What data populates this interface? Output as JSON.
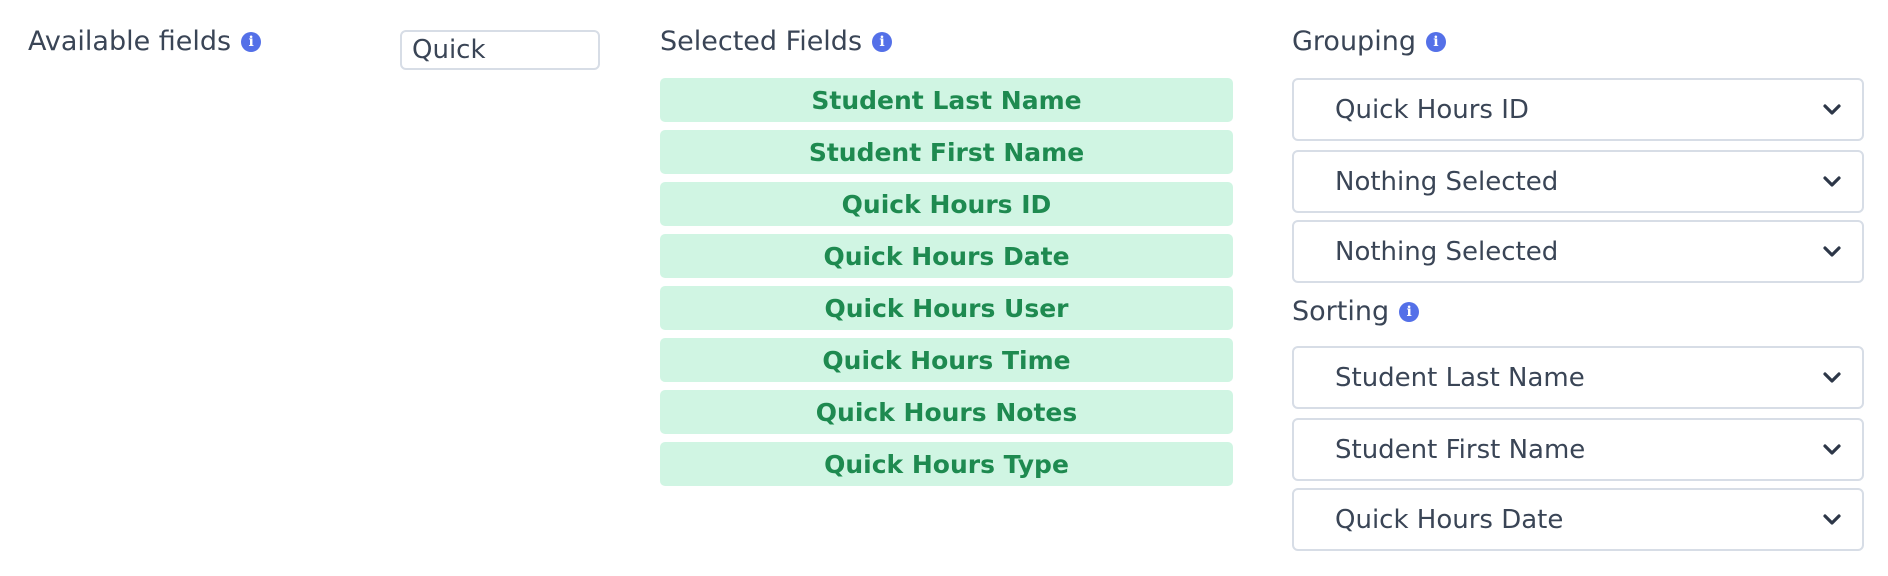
{
  "available": {
    "title": "Available fields",
    "filter_value": "Quick",
    "info_icon": "info-icon"
  },
  "selected": {
    "title": "Selected Fields",
    "info_icon": "info-icon",
    "fields": [
      "Student Last Name",
      "Student First Name",
      "Quick Hours ID",
      "Quick Hours Date",
      "Quick Hours User",
      "Quick Hours Time",
      "Quick Hours Notes",
      "Quick Hours Type"
    ]
  },
  "grouping": {
    "title": "Grouping",
    "info_icon": "info-icon",
    "selects": [
      "Quick Hours ID",
      "Nothing Selected",
      "Nothing Selected"
    ]
  },
  "sorting": {
    "title": "Sorting",
    "info_icon": "info-icon",
    "selects": [
      "Student Last Name",
      "Student First Name",
      "Quick Hours Date"
    ]
  },
  "colors": {
    "chip_background": "#d0f5e3",
    "chip_text": "#1e8a50",
    "info_icon": "#5470e8",
    "border": "#d7dde6"
  }
}
